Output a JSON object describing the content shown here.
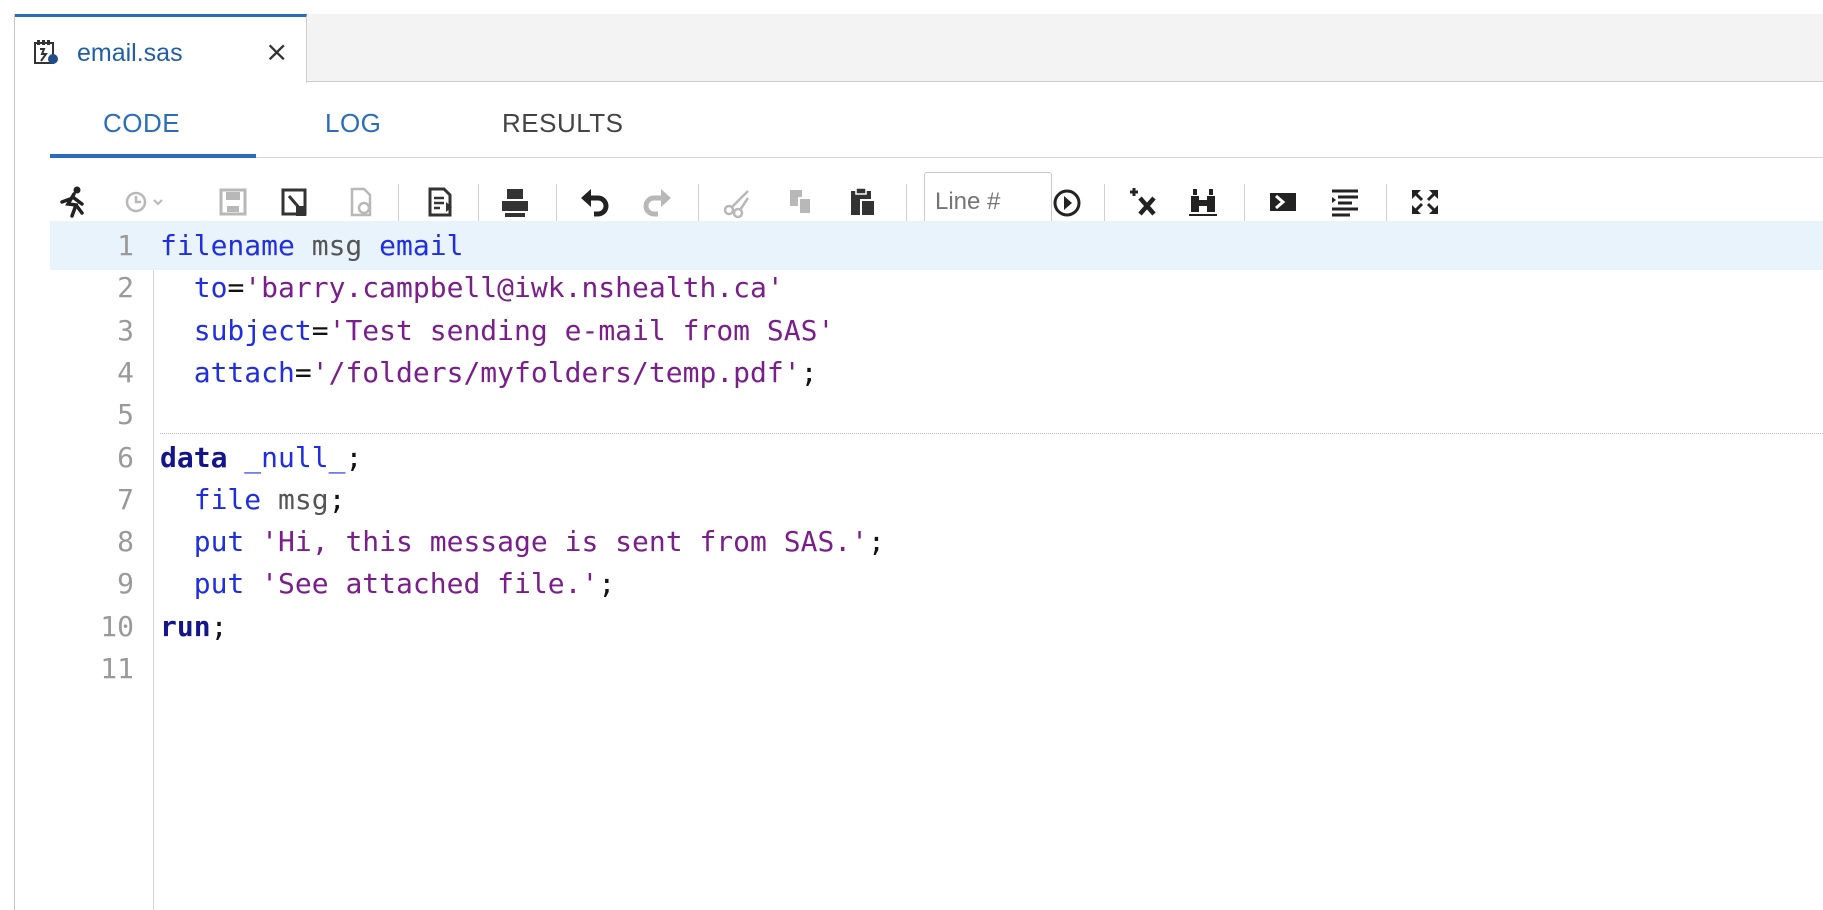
{
  "file_tab": {
    "filename": "email.sas",
    "close_glyph": "×",
    "icon": "sas-program-icon"
  },
  "view_tabs": [
    {
      "label": "CODE",
      "active": true
    },
    {
      "label": "LOG",
      "active": false
    },
    {
      "label": "RESULTS",
      "active": false
    }
  ],
  "toolbar": {
    "buttons": [
      "run-icon",
      "history-dropdown-icon",
      "save-icon",
      "save-as-icon",
      "open-icon",
      "log-icon",
      "print-icon",
      "undo-icon",
      "redo-icon",
      "cut-icon",
      "copy-icon",
      "paste-icon",
      "go-to-line-icon",
      "clear-icon",
      "find-replace-icon",
      "snippet-icon",
      "format-code-icon",
      "maximize-icon"
    ],
    "line_placeholder": "Line #"
  },
  "editor": {
    "current_line": 1,
    "lines": [
      {
        "n": "1",
        "tokens": [
          [
            "kw",
            "filename"
          ],
          [
            "id",
            " msg "
          ],
          [
            "kw",
            "email"
          ]
        ]
      },
      {
        "n": "2",
        "tokens": [
          [
            "id",
            "  "
          ],
          [
            "kw",
            "to"
          ],
          [
            "pn",
            "="
          ],
          [
            "str",
            "'barry.campbell@iwk.nshealth.ca'"
          ]
        ]
      },
      {
        "n": "3",
        "tokens": [
          [
            "id",
            "  "
          ],
          [
            "kw",
            "subject"
          ],
          [
            "pn",
            "="
          ],
          [
            "str",
            "'Test sending e-mail from SAS'"
          ]
        ]
      },
      {
        "n": "4",
        "tokens": [
          [
            "id",
            "  "
          ],
          [
            "kw",
            "attach"
          ],
          [
            "pn",
            "="
          ],
          [
            "str",
            "'/folders/myfolders/temp.pdf'"
          ],
          [
            "pn",
            ";"
          ]
        ]
      },
      {
        "n": "5",
        "tokens": []
      },
      {
        "n": "6",
        "tokens": [
          [
            "kwb",
            "data"
          ],
          [
            "id",
            " "
          ],
          [
            "kw",
            "_null_"
          ],
          [
            "pn",
            ";"
          ]
        ]
      },
      {
        "n": "7",
        "tokens": [
          [
            "id",
            "  "
          ],
          [
            "kw",
            "file"
          ],
          [
            "id",
            " msg"
          ],
          [
            "pn",
            ";"
          ]
        ]
      },
      {
        "n": "8",
        "tokens": [
          [
            "id",
            "  "
          ],
          [
            "kw",
            "put"
          ],
          [
            "id",
            " "
          ],
          [
            "str",
            "'Hi, this message is sent from SAS.'"
          ],
          [
            "pn",
            ";"
          ]
        ]
      },
      {
        "n": "9",
        "tokens": [
          [
            "id",
            "  "
          ],
          [
            "kw",
            "put"
          ],
          [
            "id",
            " "
          ],
          [
            "str",
            "'See attached file.'"
          ],
          [
            "pn",
            ";"
          ]
        ]
      },
      {
        "n": "10",
        "tokens": [
          [
            "kwb",
            "run"
          ],
          [
            "pn",
            ";"
          ]
        ]
      },
      {
        "n": "11",
        "tokens": []
      }
    ]
  },
  "colors": {
    "accent": "#2a6ebb",
    "keyword": "#1f2fe0",
    "string": "#7a1e8c",
    "current_line_bg": "#e9f3fc"
  }
}
